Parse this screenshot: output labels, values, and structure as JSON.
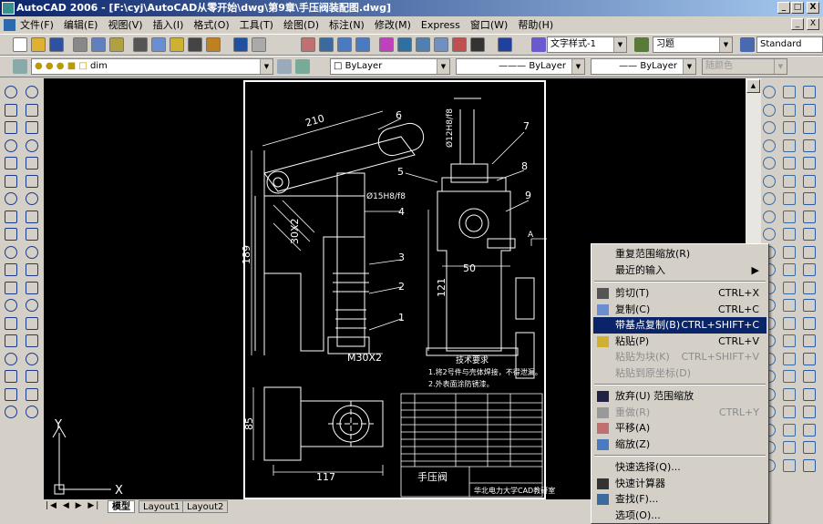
{
  "window": {
    "title": "AutoCAD 2006 - [F:\\cyj\\AutoCAD从零开始\\dwg\\第9章\\手压阀装配图.dwg]",
    "min": "_",
    "max": "□",
    "close": "X",
    "doc_min": "_",
    "doc_restore": "ƒ",
    "doc_close": "X"
  },
  "menu": [
    "文件(F)",
    "编辑(E)",
    "视图(V)",
    "插入(I)",
    "格式(O)",
    "工具(T)",
    "绘图(D)",
    "标注(N)",
    "修改(M)",
    "Express",
    "窗口(W)",
    "帮助(H)"
  ],
  "toolbar": {
    "text_style": "文字样式-1",
    "dim_style": "习题",
    "table_style": "Standard"
  },
  "layers": {
    "current_layer": "dim",
    "color": "ByLayer",
    "linetype": "ByLayer",
    "lineweight": "ByLayer",
    "plot_style": "随颜色"
  },
  "tabs": [
    "模型",
    "Layout1",
    "Layout2"
  ],
  "drawing": {
    "dims": {
      "d210": "210",
      "d189": "189",
      "d30x2": "30X2",
      "m30x2": "M30X2",
      "d15": "Ø15H8/f8",
      "d12": "Ø12H8/f8",
      "d50": "50",
      "d121": "121",
      "d85": "85",
      "d117": "117",
      "secA": "A"
    },
    "balloons": [
      "1",
      "2",
      "3",
      "4",
      "5",
      "6",
      "7",
      "8",
      "9"
    ],
    "tech_title": "技术要求",
    "tech_lines": [
      "1.将2号件与壳体焊接，不得泄漏。",
      "2.外表面涂防锈漆。"
    ],
    "title_block": {
      "name": "手压阀",
      "org": "华北电力大学CAD教研室"
    },
    "ucs": {
      "x": "X",
      "y": "Y"
    }
  },
  "context_menu": [
    {
      "label": "重复范围缩放(R)"
    },
    {
      "label": "最近的输入",
      "submenu": "▶"
    },
    {
      "sep": true
    },
    {
      "label": "剪切(T)",
      "shortcut": "CTRL+X",
      "icon": "scissors-icon"
    },
    {
      "label": "复制(C)",
      "shortcut": "CTRL+C",
      "icon": "copy-icon"
    },
    {
      "label": "带基点复制(B)",
      "shortcut": "CTRL+SHIFT+C",
      "selected": true
    },
    {
      "label": "粘贴(P)",
      "shortcut": "CTRL+V",
      "icon": "paste-icon"
    },
    {
      "label": "粘贴为块(K)",
      "shortcut": "CTRL+SHIFT+V",
      "disabled": true
    },
    {
      "label": "粘贴到原坐标(D)",
      "disabled": true
    },
    {
      "sep": true
    },
    {
      "label": "放弃(U) 范围缩放",
      "icon": "undo-icon"
    },
    {
      "label": "重做(R)",
      "shortcut": "CTRL+Y",
      "disabled": true,
      "icon": "redo-icon"
    },
    {
      "label": "平移(A)",
      "icon": "pan-icon"
    },
    {
      "label": "缩放(Z)",
      "icon": "zoom-icon"
    },
    {
      "sep": true
    },
    {
      "label": "快速选择(Q)..."
    },
    {
      "label": "快速计算器",
      "icon": "calculator-icon"
    },
    {
      "label": "查找(F)...",
      "icon": "find-icon"
    },
    {
      "label": "选项(O)..."
    }
  ],
  "colors": {
    "title_start": "#0a246a",
    "title_end": "#a6caf0",
    "selection": "#0a246a",
    "canvas": "#000000"
  }
}
